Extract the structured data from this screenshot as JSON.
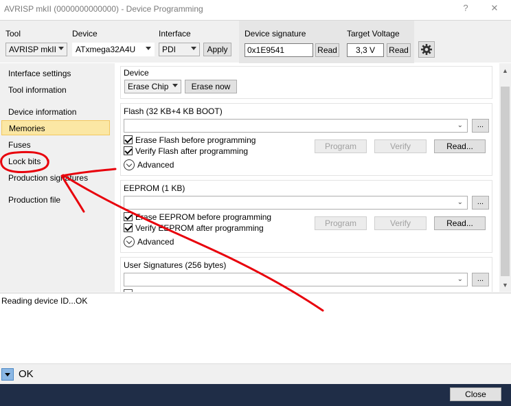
{
  "window": {
    "title": "AVRISP mkII (0000000000000) - Device Programming",
    "help_glyph": "?",
    "close_glyph": "✕"
  },
  "toolbar": {
    "tool_label": "Tool",
    "tool_value": "AVRISP mkII",
    "device_label": "Device",
    "device_value": "ATxmega32A4U",
    "interface_label": "Interface",
    "interface_value": "PDI",
    "apply_label": "Apply",
    "signature_label": "Device signature",
    "signature_value": "0x1E9541",
    "signature_read_label": "Read",
    "voltage_label": "Target Voltage",
    "voltage_value": "3,3 V",
    "voltage_read_label": "Read"
  },
  "sidebar": {
    "items": [
      {
        "label": "Interface settings"
      },
      {
        "label": "Tool information"
      },
      {
        "label": "Device information"
      },
      {
        "label": "Memories"
      },
      {
        "label": "Fuses"
      },
      {
        "label": "Lock bits"
      },
      {
        "label": "Production signatures"
      },
      {
        "label": "Production file"
      }
    ]
  },
  "memories": {
    "device_group": {
      "title": "Device",
      "erase_select": "Erase Chip",
      "erase_now_label": "Erase now"
    },
    "flash": {
      "title": "Flash (32 KB+4 KB BOOT)",
      "file_value": "",
      "browse_label": "...",
      "erase_check": "Erase Flash before programming",
      "verify_check": "Verify Flash after programming",
      "advanced_label": "Advanced",
      "program_label": "Program",
      "verify_label": "Verify",
      "read_label": "Read..."
    },
    "eeprom": {
      "title": "EEPROM (1 KB)",
      "file_value": "",
      "browse_label": "...",
      "erase_check": "Erase EEPROM before programming",
      "verify_check": "Verify EEPROM after programming",
      "advanced_label": "Advanced",
      "program_label": "Program",
      "verify_label": "Verify",
      "read_label": "Read..."
    },
    "user_sig": {
      "title": "User Signatures (256 bytes)",
      "file_value": "",
      "browse_label": "..."
    }
  },
  "log": {
    "text": "Reading device ID...OK"
  },
  "status": {
    "text": "OK"
  },
  "footer": {
    "close_label": "Close"
  },
  "colors": {
    "active_item_bg": "#fbe7a4",
    "annotation": "#e8000b",
    "footer_bg": "#1f2d47"
  }
}
